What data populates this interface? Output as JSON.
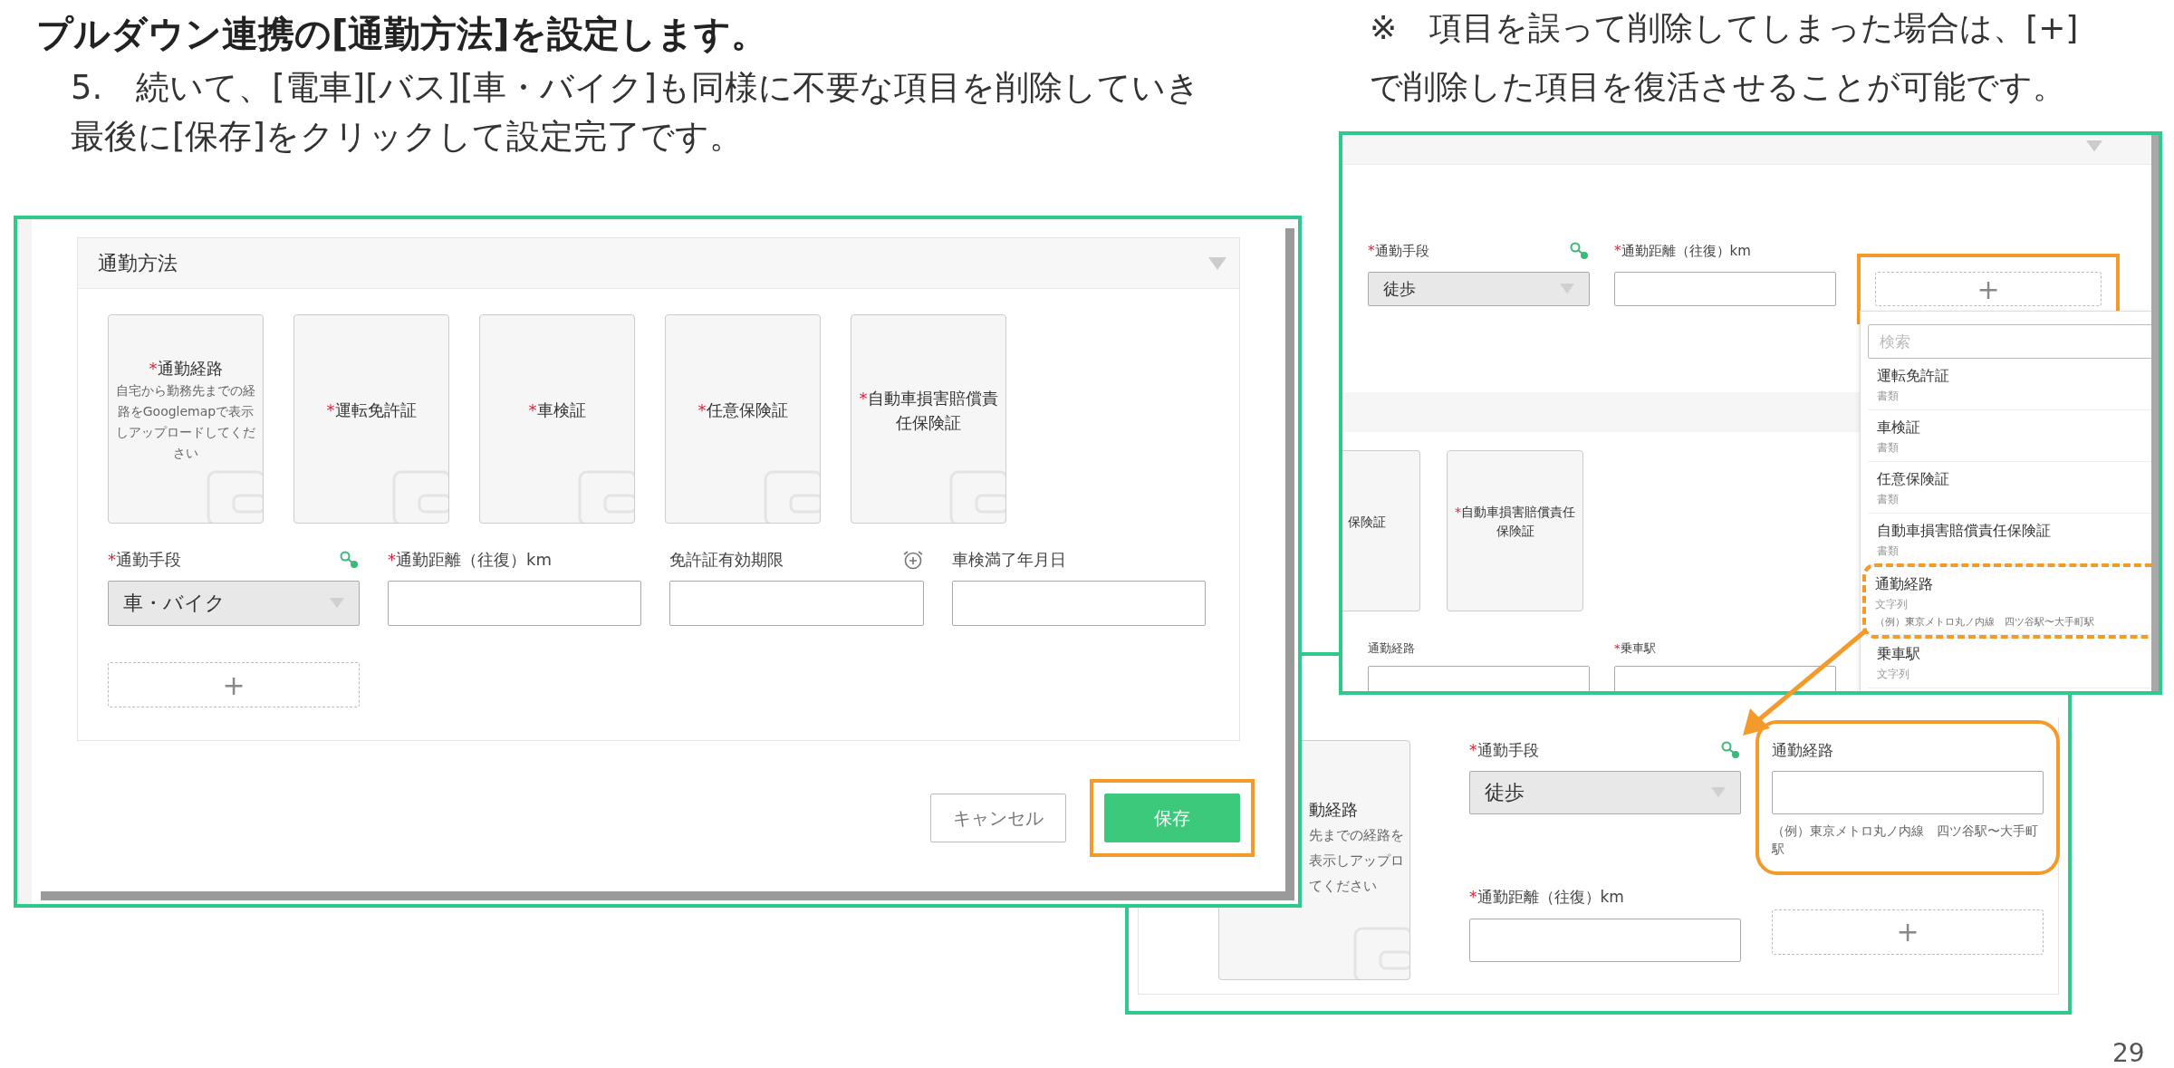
{
  "title": "プルダウン連携の[通勤方法]を設定します。",
  "instructions": [
    "5.　続いて、[電車][バス][車・バイク]も同様に不要な項目を削除していき",
    "最後に[保存]をクリックして設定完了です。"
  ],
  "note": [
    "※　項目を誤って削除してしまった場合は、[+]",
    "で削除した項目を復活させることが可能です。"
  ],
  "page_number": "29",
  "screenshot_main": {
    "section_title": "通勤方法",
    "upload_cards": [
      {
        "mark": "*",
        "label": "通勤経路",
        "hint": "自宅から勤務先までの経路をGooglemapで表示しアップロードしてください"
      },
      {
        "mark": "*",
        "label": "運転免許証"
      },
      {
        "mark": "*",
        "label": "車検証"
      },
      {
        "mark": "*",
        "label": "任意保険証"
      },
      {
        "mark": "*",
        "label": "自動車損害賠償責任保険証"
      }
    ],
    "fields": [
      {
        "kind": "select",
        "mark": "*",
        "label": "通勤手段",
        "value": "車・バイク"
      },
      {
        "kind": "input",
        "mark": "*",
        "label": "通勤距離（往復）km"
      },
      {
        "kind": "input",
        "label": "免許証有効期限"
      },
      {
        "kind": "input",
        "label": "車検満了年月日"
      }
    ],
    "add_button": "+",
    "buttons": [
      {
        "kind": "secondary",
        "label": "キャンセル",
        "highlighted": false
      },
      {
        "kind": "primary",
        "label": "保存",
        "highlighted": true
      }
    ]
  },
  "screenshot_picker": {
    "fields": [
      {
        "kind": "select",
        "mark": "*",
        "label": "通勤手段",
        "value": "徒歩"
      },
      {
        "kind": "input",
        "mark": "*",
        "label": "通勤距離（往復）km"
      }
    ],
    "add_button": "+",
    "add_highlighted": true,
    "search_placeholder": "検索",
    "options": [
      {
        "name": "運転免許証",
        "type": "書類",
        "highlighted": false
      },
      {
        "name": "車検証",
        "type": "書類",
        "highlighted": false
      },
      {
        "name": "任意保険証",
        "type": "書類",
        "highlighted": false
      },
      {
        "name": "自動車損害賠償責任保険証",
        "type": "書類",
        "highlighted": false
      },
      {
        "name": "通勤経路",
        "type": "文字列",
        "example": "（例）東京メトロ丸ノ内線　四ツ谷駅〜大手町駅",
        "highlighted": true
      },
      {
        "name": "乗車駅",
        "type": "文字列",
        "highlighted": false
      }
    ],
    "upload_cards": [
      {
        "label": "保険証"
      },
      {
        "mark": "*",
        "label": "自動車損害賠償責任保険証"
      }
    ],
    "lower_labels": [
      {
        "label": "通勤経路"
      },
      {
        "mark": "*",
        "label": "乗車駅"
      }
    ]
  },
  "screenshot_result": {
    "card": {
      "label": "動経路",
      "hint_lines": [
        "先までの経路を",
        "表示しアップロ",
        "てください"
      ]
    },
    "fields": [
      {
        "kind": "select",
        "mark": "*",
        "label": "通勤手段",
        "value": "徒歩"
      },
      {
        "kind": "input",
        "label": "通勤経路",
        "hint": "（例）東京メトロ丸ノ内線　四ツ谷駅〜大手町駅",
        "highlighted": true
      },
      {
        "kind": "input",
        "mark": "*",
        "label": "通勤距離（往復）km"
      },
      {
        "kind": "add",
        "label": "+"
      }
    ]
  }
}
